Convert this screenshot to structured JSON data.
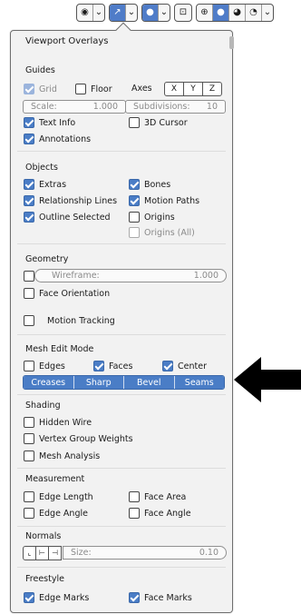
{
  "toolbar": {
    "icons": [
      "overlay-icon",
      "chevron-down-icon",
      "gizmo-icon",
      "chevron-down-icon",
      "overlays-toggle-icon",
      "chevron-down-icon",
      "xray-icon",
      "wireframe-shading-icon",
      "solid-shading-icon",
      "material-shading-icon",
      "rendered-shading-icon",
      "chevron-down-icon"
    ]
  },
  "panel": {
    "title": "Viewport Overlays",
    "guides": {
      "header": "Guides",
      "grid": "Grid",
      "floor": "Floor",
      "axes": "Axes",
      "axis_x": "X",
      "axis_y": "Y",
      "axis_z": "Z",
      "scale_label": "Scale:",
      "scale_value": "1.000",
      "subdivisions_label": "Subdivisions:",
      "subdivisions_value": "10",
      "text_info": "Text Info",
      "cursor_3d": "3D Cursor",
      "annotations": "Annotations"
    },
    "objects": {
      "header": "Objects",
      "extras": "Extras",
      "bones": "Bones",
      "relationship_lines": "Relationship Lines",
      "motion_paths": "Motion Paths",
      "outline_selected": "Outline Selected",
      "origins": "Origins",
      "origins_all": "Origins (All)"
    },
    "geometry": {
      "header": "Geometry",
      "wireframe_label": "Wireframe:",
      "wireframe_value": "1.000",
      "face_orientation": "Face Orientation",
      "motion_tracking": "Motion Tracking"
    },
    "mesh_edit": {
      "header": "Mesh Edit Mode",
      "edges": "Edges",
      "faces": "Faces",
      "center": "Center",
      "marks": [
        "Creases",
        "Sharp",
        "Bevel",
        "Seams"
      ]
    },
    "shading": {
      "header": "Shading",
      "hidden_wire": "Hidden Wire",
      "vertex_group_weights": "Vertex Group Weights",
      "mesh_analysis": "Mesh Analysis"
    },
    "measurement": {
      "header": "Measurement",
      "edge_length": "Edge Length",
      "face_area": "Face Area",
      "edge_angle": "Edge Angle",
      "face_angle": "Face Angle"
    },
    "normals": {
      "header": "Normals",
      "size_label": "Size:",
      "size_value": "0.10"
    },
    "freestyle": {
      "header": "Freestyle",
      "edge_marks": "Edge Marks",
      "face_marks": "Face Marks"
    }
  },
  "colors": {
    "accent": "#4a7dc6",
    "panel_bg": "#f2f2f2",
    "arrow": "#000000"
  }
}
